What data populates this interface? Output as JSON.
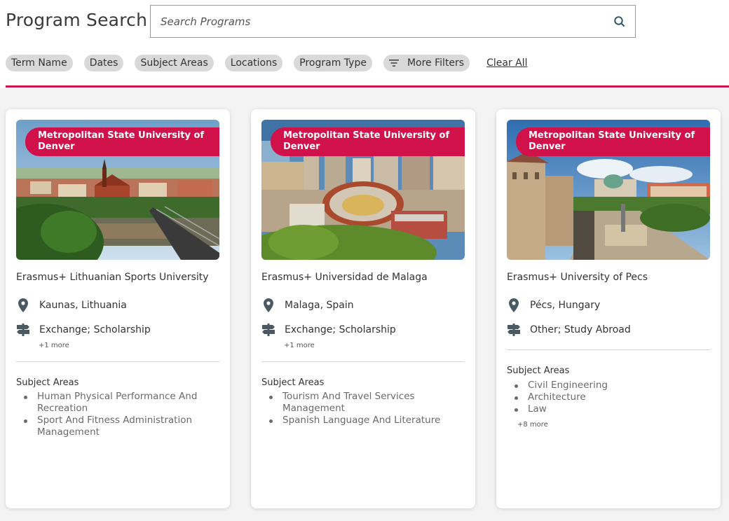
{
  "page": {
    "title": "Program Search"
  },
  "search": {
    "placeholder": "Search Programs"
  },
  "filters": {
    "term": "Term Name",
    "dates": "Dates",
    "subjects": "Subject Areas",
    "locations": "Locations",
    "program_type": "Program Type",
    "more": "More Filters",
    "clear": "Clear All"
  },
  "cards": [
    {
      "provider": "Metropolitan State University of Denver",
      "name": "Erasmus+ Lithuanian Sports University",
      "location": "Kaunas, Lithuania",
      "types": "Exchange; Scholarship",
      "types_more": "+1 more",
      "subjects_label": "Subject Areas",
      "subjects": [
        "Human Physical Performance And Recreation",
        "Sport And Fitness Administration Management"
      ]
    },
    {
      "provider": "Metropolitan State University of Denver",
      "name": "Erasmus+ Universidad de Malaga",
      "location": "Malaga, Spain",
      "types": "Exchange; Scholarship",
      "types_more": "+1 more",
      "subjects_label": "Subject Areas",
      "subjects": [
        "Tourism And Travel Services Management",
        "Spanish Language And Literature"
      ]
    },
    {
      "provider": "Metropolitan State University of Denver",
      "name": "Erasmus+ University of Pecs",
      "location": "Pécs, Hungary",
      "types": "Other; Study Abroad",
      "subjects_label": "Subject Areas",
      "subjects": [
        "Civil Engineering",
        "Architecture",
        "Law"
      ],
      "subjects_more": "+8 more"
    }
  ],
  "colors": {
    "accent": "#c8174a",
    "badge": "#d0114a",
    "icon": "#4a5a63"
  },
  "icons": {
    "search": "search-icon",
    "filter": "filter-icon",
    "location": "location-pin-icon",
    "type": "signpost-icon"
  }
}
